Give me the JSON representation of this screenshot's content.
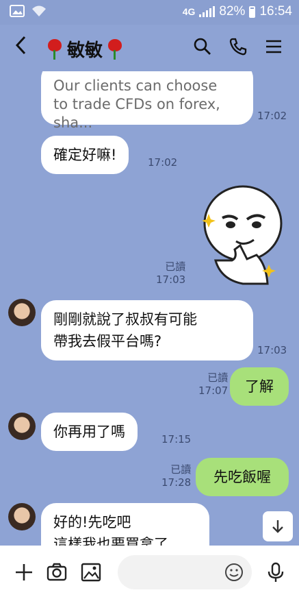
{
  "status_bar": {
    "network": "4G",
    "battery": "82%",
    "time": "16:54"
  },
  "header": {
    "back_icon": "chevron-left-icon",
    "contact_name": "敏敏",
    "icons": [
      "search-icon",
      "phone-icon",
      "menu-icon"
    ]
  },
  "messages": [
    {
      "from": "contact",
      "lines": [
        "Our clients can choose",
        "to trade CFDs on forex, sha..."
      ],
      "time": "17:02"
    },
    {
      "from": "contact",
      "lines": [
        "確定好嘛!"
      ],
      "time": "17:02"
    },
    {
      "from": "me",
      "type": "sticker",
      "read": "已讀",
      "time": "17:03"
    },
    {
      "from": "contact",
      "lines": [
        "剛剛就說了叔叔有可能",
        "帶我去假平台嗎?"
      ],
      "time": "17:03"
    },
    {
      "from": "me",
      "lines": [
        "了解"
      ],
      "read": "已讀",
      "time": "17:07"
    },
    {
      "from": "contact",
      "lines": [
        "你再用了嗎"
      ],
      "time": "17:15"
    },
    {
      "from": "me",
      "lines": [
        "先吃飯喔"
      ],
      "read": "已讀",
      "time": "17:28"
    },
    {
      "from": "contact",
      "lines": [
        "好的!先吃吧",
        "這樣我也要買拿了"
      ]
    }
  ],
  "input_bar": {
    "icons": [
      "plus-icon",
      "camera-icon",
      "image-icon",
      "emoji-icon",
      "microphone-icon"
    ],
    "placeholder": ""
  },
  "colors": {
    "chat_bg": "#8ea3d4",
    "my_bubble": "#a8e07a",
    "their_bubble": "#ffffff"
  }
}
